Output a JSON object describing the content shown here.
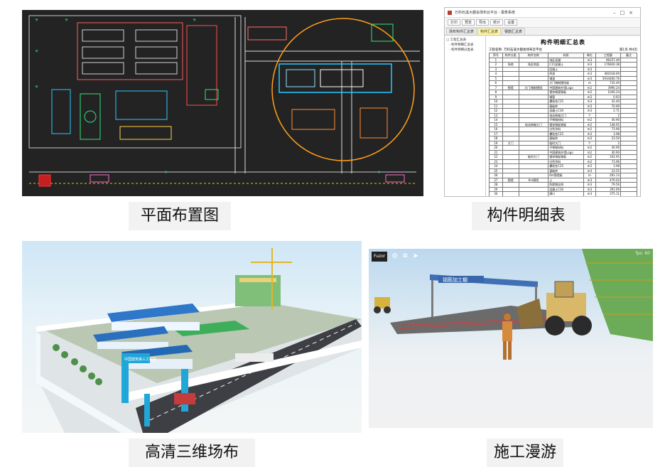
{
  "panels": {
    "cad": {
      "caption": "平面布置图"
    },
    "table": {
      "caption": "构件明细表",
      "window_title": "万科石溪大都会场布云平台 - 报表系统",
      "toolbar": [
        "打印",
        "预览",
        "导出",
        "统计",
        "设置"
      ],
      "tabs": [
        "场布构件汇总表",
        "构件汇总表",
        "钢筋汇总表"
      ],
      "tree": [
        "□ 工程汇总表",
        "- 构件明细汇总表",
        "- 构件明细分类表"
      ],
      "sheet_title": "构件明细汇总表",
      "meta_left": "工程名称: 万科石溪大都会场布云平台",
      "meta_right": "第1页 共4页",
      "headers": [
        "序号",
        "构件分类",
        "构件名称",
        "材质",
        "单位",
        "工程量",
        "备注"
      ],
      "rows": [
        [
          "1",
          "",
          "",
          "场区混凝",
          "m3",
          "96257.49",
          ""
        ],
        [
          "2",
          "场地",
          "场区地面",
          "C15混凝土",
          "m3",
          "176830.38",
          ""
        ],
        [
          "3",
          "",
          "",
          "回填土",
          "m3",
          "",
          ""
        ],
        [
          "4",
          "",
          "",
          "砖渣",
          "m3",
          "460318.69",
          ""
        ],
        [
          "5",
          "",
          "",
          "钢渣",
          "m3",
          "5934460.76",
          ""
        ],
        [
          "6",
          "",
          "",
          "大门钢制围挡板",
          "m",
          "735.49",
          ""
        ],
        [
          "7",
          "围墙",
          "大门/钢制围挡",
          "中国建筑外墙Logo",
          "m2",
          "3990.24",
          ""
        ],
        [
          "8",
          "",
          "",
          "镀锌钢管钢板",
          "m2",
          "1040.24",
          ""
        ],
        [
          "9",
          "",
          "",
          "钢管",
          "m3",
          "0.93",
          ""
        ],
        [
          "10",
          "",
          "",
          "螺栓柱C25",
          "m3",
          "32.40",
          ""
        ],
        [
          "11",
          "",
          "",
          "基础砖",
          "m3",
          "70.90",
          ""
        ],
        [
          "12",
          "",
          "",
          "混凝土C30",
          "m3",
          "2.71",
          ""
        ],
        [
          "13",
          "",
          "",
          "电动伸缩大门",
          "个",
          "2",
          ""
        ],
        [
          "14",
          "",
          "",
          "不锈钢材料",
          "m2",
          "40.90",
          ""
        ],
        [
          "15",
          "",
          "电动伸缩大门",
          "镀锌钢板钢板",
          "m2",
          "148.95",
          ""
        ],
        [
          "16",
          "",
          "",
          "白色涂料",
          "m2",
          "73.96",
          ""
        ],
        [
          "17",
          "",
          "",
          "螺栓柱C25",
          "m3",
          "3.98",
          ""
        ],
        [
          "18",
          "",
          "",
          "基础砖",
          "m3",
          "23.50",
          ""
        ],
        [
          "19",
          "大门",
          "",
          "临时大门",
          "个",
          "2",
          ""
        ],
        [
          "20",
          "",
          "",
          "不锈钢材料",
          "m2",
          "40.90",
          ""
        ],
        [
          "21",
          "",
          "",
          "中国建筑外墙Logo",
          "m2",
          "40.90",
          ""
        ],
        [
          "22",
          "",
          "临时大门",
          "镀锌钢板钢板",
          "m2",
          "102.95",
          ""
        ],
        [
          "23",
          "",
          "",
          "白色涂料",
          "m2",
          "73.96",
          ""
        ],
        [
          "24",
          "",
          "",
          "螺栓柱C25",
          "m3",
          "3.98",
          ""
        ],
        [
          "25",
          "",
          "",
          "基础砖",
          "m3",
          "23.55",
          ""
        ],
        [
          "26",
          "",
          "",
          "6m围墙板",
          "m",
          "261.13",
          ""
        ],
        [
          "27",
          "围墙",
          "6m围墙",
          "土",
          "m3",
          "470.03",
          ""
        ],
        [
          "28",
          "",
          "",
          "防腐钢丝网",
          "m3",
          "79.56",
          ""
        ],
        [
          "29",
          "",
          "",
          "混凝土C30",
          "m3",
          "391.69",
          ""
        ],
        [
          "30",
          "",
          "",
          "脚口",
          "m3",
          "375.11",
          ""
        ]
      ]
    },
    "scene3d": {
      "caption": "高清三维场布",
      "gate_label": "中国建筑第三工程局"
    },
    "walk": {
      "caption": "施工漫游",
      "shed_label": "钢筋加工棚",
      "fps": "fps: 60",
      "hud_logo": "Fuzor"
    }
  }
}
